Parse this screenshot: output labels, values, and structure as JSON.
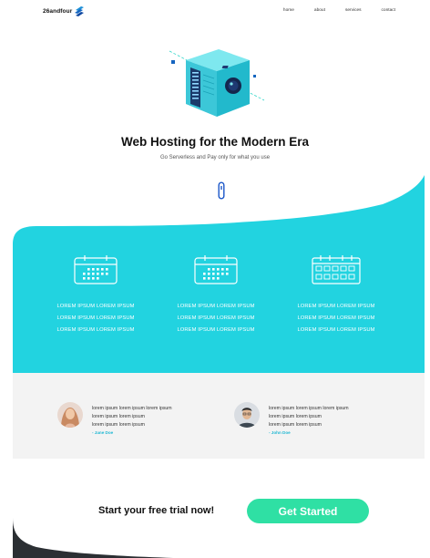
{
  "brand": {
    "name": "26andfour"
  },
  "nav": {
    "links": [
      {
        "label": "home"
      },
      {
        "label": "about"
      },
      {
        "label": "services"
      },
      {
        "label": "contact"
      }
    ]
  },
  "hero": {
    "title": "Web Hosting for the Modern Era",
    "subtitle": "Go Serverless and Pay only for what you use"
  },
  "features": [
    {
      "lines": [
        "LOREM IPSUM LOREM IPSUM",
        "LOREM IPSUM LOREM IPSUM",
        "LOREM IPSUM LOREM IPSUM"
      ],
      "icon": "calendar-icon"
    },
    {
      "lines": [
        "LOREM IPSUM LOREM IPSUM",
        "LOREM IPSUM LOREM IPSUM",
        "LOREM IPSUM LOREM IPSUM"
      ],
      "icon": "calendar-icon"
    },
    {
      "lines": [
        "LOREM IPSUM LOREM IPSUM",
        "LOREM IPSUM LOREM IPSUM",
        "LOREM IPSUM LOREM IPSUM"
      ],
      "icon": "calendar-grid-icon"
    }
  ],
  "testimonials": [
    {
      "lines": [
        "lorem ipsum lorem ipsum lorem ipsum",
        "lorem ipsum lorem ipsum",
        "lorem ipsum lorem ipsum"
      ],
      "author": "- Jane Doe"
    },
    {
      "lines": [
        "lorem ipsum lorem ipsum lorem ipsum",
        "lorem ipsum lorem ipsum",
        "lorem ipsum lorem ipsum"
      ],
      "author": "- John Doe"
    }
  ],
  "cta": {
    "text": "Start your free trial now!",
    "button_label": "Get Started"
  },
  "colors": {
    "teal": "#22d3e0",
    "cta_green": "#2fe0a4",
    "author_blue": "#20b8d3",
    "footer_dark": "#2b2f33"
  }
}
